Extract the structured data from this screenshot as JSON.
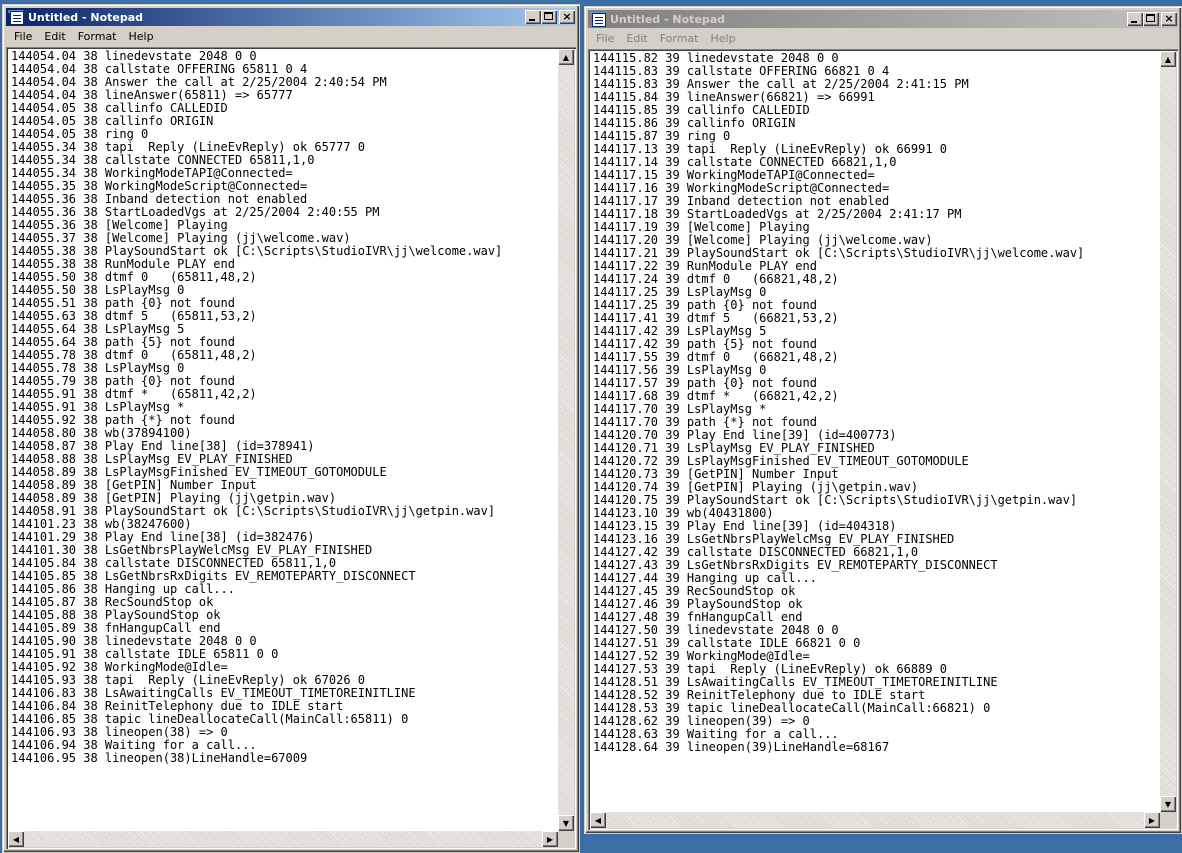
{
  "windows": [
    {
      "title": "Untitled - Notepad",
      "active": true,
      "menu": [
        "File",
        "Edit",
        "Format",
        "Help"
      ],
      "lines": [
        "144054.04 38 linedevstate 2048 0 0",
        "144054.04 38 callstate OFFERING 65811 0 4",
        "144054.04 38 Answer the call at 2/25/2004 2:40:54 PM",
        "144054.04 38 lineAnswer(65811) => 65777",
        "144054.05 38 callinfo CALLEDID",
        "144054.05 38 callinfo ORIGIN",
        "144054.05 38 ring 0",
        "144055.34 38 tapi  Reply (LineEvReply) ok 65777 0",
        "144055.34 38 callstate CONNECTED 65811,1,0",
        "144055.34 38 WorkingModeTAPI@Connected=",
        "144055.35 38 WorkingModeScript@Connected=",
        "144055.36 38 Inband detection not enabled",
        "144055.36 38 StartLoadedVgs at 2/25/2004 2:40:55 PM",
        "144055.36 38 [Welcome] Playing",
        "144055.37 38 [Welcome] Playing (jj\\welcome.wav)",
        "144055.38 38 PlaySoundStart ok [C:\\Scripts\\StudioIVR\\jj\\welcome.wav]",
        "144055.38 38 RunModule PLAY end",
        "144055.50 38 dtmf 0   (65811,48,2)",
        "144055.50 38 LsPlayMsg 0",
        "144055.51 38 path {0} not found",
        "144055.63 38 dtmf 5   (65811,53,2)",
        "144055.64 38 LsPlayMsg 5",
        "144055.64 38 path {5} not found",
        "144055.78 38 dtmf 0   (65811,48,2)",
        "144055.78 38 LsPlayMsg 0",
        "144055.79 38 path {0} not found",
        "144055.91 38 dtmf *   (65811,42,2)",
        "144055.91 38 LsPlayMsg *",
        "144055.92 38 path {*} not found",
        "144058.80 38 wb(37894100)",
        "144058.87 38 Play End line[38] (id=378941)",
        "144058.88 38 LsPlayMsg EV_PLAY_FINISHED",
        "144058.89 38 LsPlayMsgFinished EV_TIMEOUT_GOTOMODULE",
        "144058.89 38 [GetPIN] Number Input",
        "144058.89 38 [GetPIN] Playing (jj\\getpin.wav)",
        "144058.91 38 PlaySoundStart ok [C:\\Scripts\\StudioIVR\\jj\\getpin.wav]",
        "144101.23 38 wb(38247600)",
        "144101.29 38 Play End line[38] (id=382476)",
        "144101.30 38 LsGetNbrsPlayWelcMsg EV_PLAY_FINISHED",
        "144105.84 38 callstate DISCONNECTED 65811,1,0",
        "144105.85 38 LsGetNbrsRxDigits EV_REMOTEPARTY_DISCONNECT",
        "144105.86 38 Hanging up call...",
        "144105.87 38 RecSoundStop ok",
        "144105.88 38 PlaySoundStop ok",
        "144105.89 38 fnHangupCall end",
        "144105.90 38 linedevstate 2048 0 0",
        "144105.91 38 callstate IDLE 65811 0 0",
        "144105.92 38 WorkingMode@Idle=",
        "144105.93 38 tapi  Reply (LineEvReply) ok 67026 0",
        "144106.83 38 LsAwaitingCalls EV_TIMEOUT_TIMETOREINITLINE",
        "144106.84 38 ReinitTelephony due to IDLE start",
        "144106.85 38 tapic lineDeallocateCall(MainCall:65811) 0",
        "144106.93 38 lineopen(38) => 0",
        "144106.94 38 Waiting for a call...",
        "144106.95 38 lineopen(38)LineHandle=67009"
      ]
    },
    {
      "title": "Untitled - Notepad",
      "active": false,
      "menu": [
        "File",
        "Edit",
        "Format",
        "Help"
      ],
      "lines": [
        "144115.82 39 linedevstate 2048 0 0",
        "144115.83 39 callstate OFFERING 66821 0 4",
        "144115.83 39 Answer the call at 2/25/2004 2:41:15 PM",
        "144115.84 39 lineAnswer(66821) => 66991",
        "144115.85 39 callinfo CALLEDID",
        "144115.86 39 callinfo ORIGIN",
        "144115.87 39 ring 0",
        "144117.13 39 tapi  Reply (LineEvReply) ok 66991 0",
        "144117.14 39 callstate CONNECTED 66821,1,0",
        "144117.15 39 WorkingModeTAPI@Connected=",
        "144117.16 39 WorkingModeScript@Connected=",
        "144117.17 39 Inband detection not enabled",
        "144117.18 39 StartLoadedVgs at 2/25/2004 2:41:17 PM",
        "144117.19 39 [Welcome] Playing",
        "144117.20 39 [Welcome] Playing (jj\\welcome.wav)",
        "144117.21 39 PlaySoundStart ok [C:\\Scripts\\StudioIVR\\jj\\welcome.wav]",
        "144117.22 39 RunModule PLAY end",
        "144117.24 39 dtmf 0   (66821,48,2)",
        "144117.25 39 LsPlayMsg 0",
        "144117.25 39 path {0} not found",
        "144117.41 39 dtmf 5   (66821,53,2)",
        "144117.42 39 LsPlayMsg 5",
        "144117.42 39 path {5} not found",
        "144117.55 39 dtmf 0   (66821,48,2)",
        "144117.56 39 LsPlayMsg 0",
        "144117.57 39 path {0} not found",
        "144117.68 39 dtmf *   (66821,42,2)",
        "144117.70 39 LsPlayMsg *",
        "144117.70 39 path {*} not found",
        "144120.70 39 Play End line[39] (id=400773)",
        "144120.71 39 LsPlayMsg EV_PLAY_FINISHED",
        "144120.72 39 LsPlayMsgFinished EV_TIMEOUT_GOTOMODULE",
        "144120.73 39 [GetPIN] Number Input",
        "144120.74 39 [GetPIN] Playing (jj\\getpin.wav)",
        "144120.75 39 PlaySoundStart ok [C:\\Scripts\\StudioIVR\\jj\\getpin.wav]",
        "144123.10 39 wb(40431800)",
        "144123.15 39 Play End line[39] (id=404318)",
        "144123.16 39 LsGetNbrsPlayWelcMsg EV_PLAY_FINISHED",
        "144127.42 39 callstate DISCONNECTED 66821,1,0",
        "144127.43 39 LsGetNbrsRxDigits EV_REMOTEPARTY_DISCONNECT",
        "144127.44 39 Hanging up call...",
        "144127.45 39 RecSoundStop ok",
        "144127.46 39 PlaySoundStop ok",
        "144127.48 39 fnHangupCall end",
        "144127.50 39 linedevstate 2048 0 0",
        "144127.51 39 callstate IDLE 66821 0 0",
        "144127.52 39 WorkingMode@Idle=",
        "144127.53 39 tapi  Reply (LineEvReply) ok 66889 0",
        "144128.51 39 LsAwaitingCalls EV_TIMEOUT_TIMETOREINITLINE",
        "144128.52 39 ReinitTelephony due to IDLE start",
        "144128.53 39 tapic lineDeallocateCall(MainCall:66821) 0",
        "144128.62 39 lineopen(39) => 0",
        "144128.63 39 Waiting for a call...",
        "144128.64 39 lineopen(39)LineHandle=68167"
      ]
    }
  ],
  "colors": {
    "active_title_start": "#0a246a",
    "active_title_end": "#a6caf0",
    "inactive_title_start": "#808080",
    "inactive_title_end": "#c0c0c0",
    "desktop": "#3a6ea5"
  },
  "icons": [
    "notepad-icon",
    "minimize-icon",
    "maximize-icon",
    "close-icon",
    "scroll-up-icon",
    "scroll-down-icon",
    "scroll-left-icon",
    "scroll-right-icon"
  ]
}
